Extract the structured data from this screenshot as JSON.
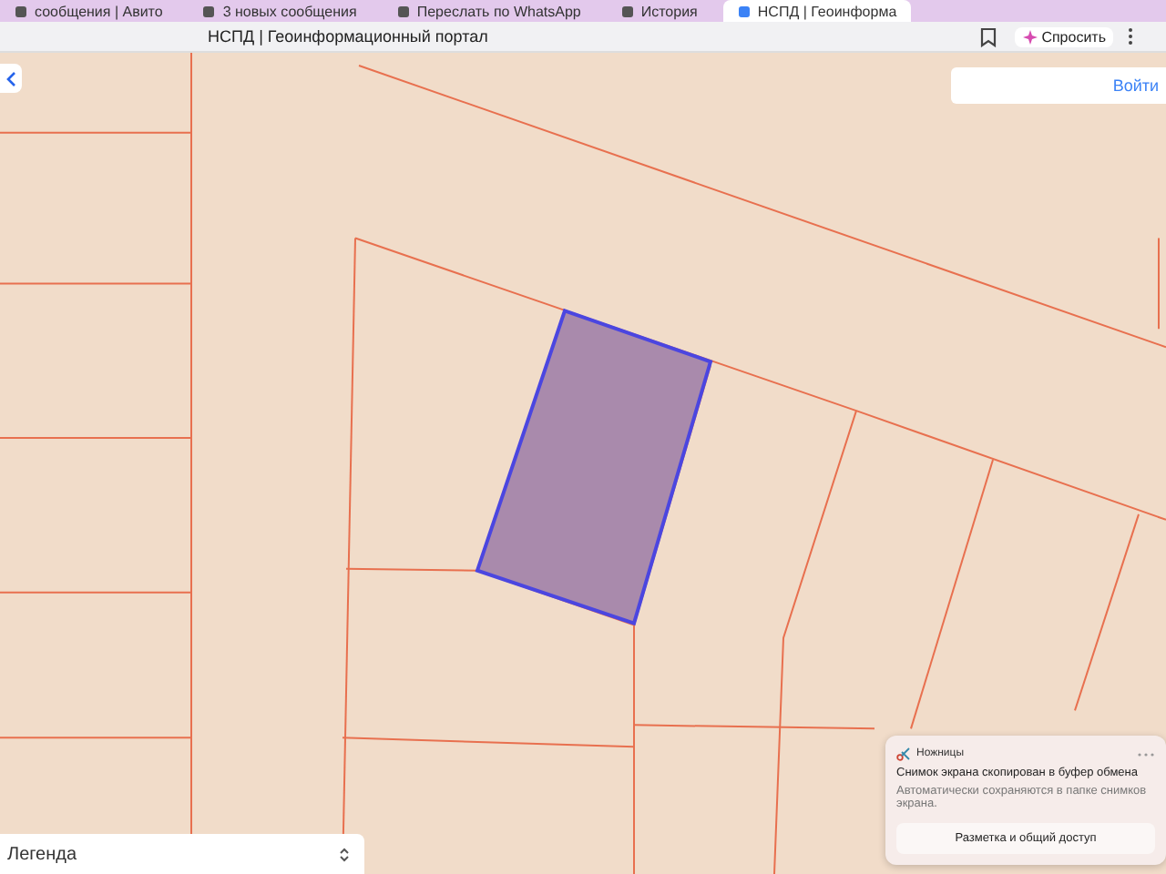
{
  "tabs": [
    {
      "label": "сообщения | Авито",
      "selected": false
    },
    {
      "label": "3 новых сообщения",
      "selected": false
    },
    {
      "label": "Переслать по WhatsApp",
      "selected": false
    },
    {
      "label": "История",
      "selected": false
    },
    {
      "label": "НСПД | Геоинформа",
      "selected": true
    }
  ],
  "address_bar": {
    "title": "НСПД | Геоинформационный портал",
    "ask_button": "Спросить"
  },
  "map": {
    "login_button": "Войти",
    "legend": {
      "label": "Легенда"
    }
  },
  "notification": {
    "app": "Ножницы",
    "title": "Снимок экрана скопирован в буфер обмена",
    "body": "Автоматически сохраняются в папке снимков экрана.",
    "action": "Разметка и общий доступ"
  }
}
